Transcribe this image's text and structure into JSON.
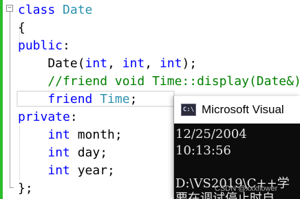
{
  "editor": {
    "lines": [
      {
        "parts": [
          {
            "text": "class ",
            "cls": "kw"
          },
          {
            "text": "Date",
            "cls": "type"
          }
        ]
      },
      {
        "parts": [
          {
            "text": "{",
            "cls": ""
          }
        ]
      },
      {
        "parts": [
          {
            "text": "public",
            "cls": "kw"
          },
          {
            "text": ":",
            "cls": ""
          }
        ]
      },
      {
        "parts": [
          {
            "text": "    Date(",
            "cls": ""
          },
          {
            "text": "int",
            "cls": "kw"
          },
          {
            "text": ", ",
            "cls": ""
          },
          {
            "text": "int",
            "cls": "kw"
          },
          {
            "text": ", ",
            "cls": ""
          },
          {
            "text": "int",
            "cls": "kw"
          },
          {
            "text": ");",
            "cls": ""
          }
        ]
      },
      {
        "parts": [
          {
            "text": "    //friend void Time::display(Date&);",
            "cls": "cm"
          }
        ]
      },
      {
        "parts": [
          {
            "text": "    ",
            "cls": ""
          },
          {
            "text": "friend ",
            "cls": "kw"
          },
          {
            "text": "Time",
            "cls": "type"
          },
          {
            "text": ";",
            "cls": ""
          }
        ]
      },
      {
        "parts": [
          {
            "text": "private",
            "cls": "kw"
          },
          {
            "text": ":",
            "cls": ""
          }
        ]
      },
      {
        "parts": [
          {
            "text": "    ",
            "cls": ""
          },
          {
            "text": "int",
            "cls": "kw"
          },
          {
            "text": " month;",
            "cls": ""
          }
        ]
      },
      {
        "parts": [
          {
            "text": "    ",
            "cls": ""
          },
          {
            "text": "int",
            "cls": "kw"
          },
          {
            "text": " day;",
            "cls": ""
          }
        ]
      },
      {
        "parts": [
          {
            "text": "    ",
            "cls": ""
          },
          {
            "text": "int",
            "cls": "kw"
          },
          {
            "text": " year;",
            "cls": ""
          }
        ]
      },
      {
        "parts": [
          {
            "text": "};",
            "cls": ""
          }
        ]
      }
    ],
    "fold_glyph": "−"
  },
  "console": {
    "icon_label": "C:\\",
    "title": "Microsoft Visual",
    "output_lines": [
      "12/25/2004",
      "10:13:56",
      "",
      "D:\\VS2019\\C++学",
      "要在调试停止时自"
    ]
  },
  "watermark": "CSDN @xxxflower",
  "colors": {
    "keyword": "#0000ff",
    "type": "#2b91af",
    "comment": "#008000",
    "console_bg": "#0c0c0c",
    "gutter_green": "#2dbb2d"
  }
}
